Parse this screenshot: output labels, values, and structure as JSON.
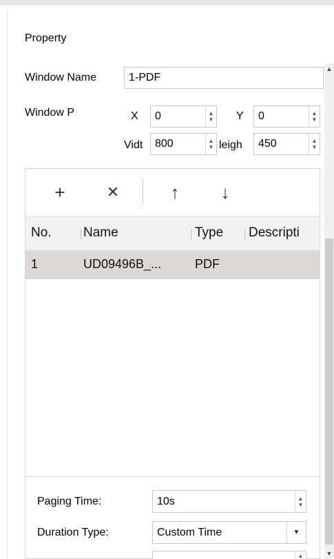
{
  "panel": {
    "title": "Property"
  },
  "window_name": {
    "label": "Window Name",
    "value": "1-PDF"
  },
  "window_position": {
    "label": "Window P",
    "x_label": "X",
    "x_value": "0",
    "y_label": "Y",
    "y_value": "0",
    "width_label": "Vidt",
    "width_value": "800",
    "height_label": "leigh",
    "height_value": "450"
  },
  "toolbar": {
    "add_icon": "+",
    "delete_icon": "✕",
    "up_icon": "↑",
    "down_icon": "↓"
  },
  "table": {
    "columns": [
      "No.",
      "Name",
      "Type",
      "Descripti"
    ],
    "rows": [
      {
        "no": "1",
        "name": "UD09496B_...",
        "type": "PDF",
        "description": ""
      }
    ]
  },
  "paging_time": {
    "label": "Paging Time:",
    "value": "10s"
  },
  "duration_type": {
    "label": "Duration Type:",
    "value": "Custom Time"
  }
}
